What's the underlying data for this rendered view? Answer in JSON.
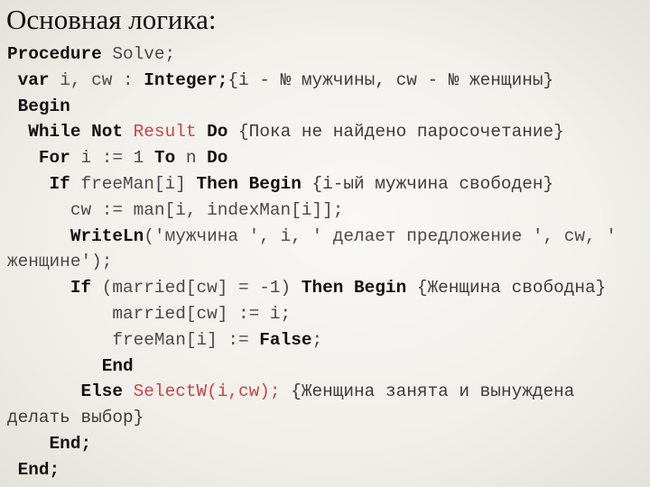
{
  "slide": {
    "title": "Основная логика:",
    "colors": {
      "background": "#f1efe9",
      "keyword": "#111111",
      "text": "#444444",
      "highlight": "#c8444a"
    },
    "code_lines": [
      {
        "indent": 0,
        "tokens": [
          {
            "t": "Procedure",
            "k": "kw"
          },
          {
            "t": " Solve;",
            "k": "id"
          }
        ]
      },
      {
        "indent": 1,
        "tokens": [
          {
            "t": "var",
            "k": "kw"
          },
          {
            "t": " i, cw : ",
            "k": "id"
          },
          {
            "t": "Integer;",
            "k": "kw"
          },
          {
            "t": "{i - № мужчины, cw - № женщины}",
            "k": "cm"
          }
        ]
      },
      {
        "indent": 1,
        "tokens": [
          {
            "t": "Begin",
            "k": "kw"
          }
        ]
      },
      {
        "indent": 2,
        "tokens": [
          {
            "t": "While Not",
            "k": "kw"
          },
          {
            "t": " ",
            "k": "id"
          },
          {
            "t": "Result",
            "k": "red"
          },
          {
            "t": " ",
            "k": "id"
          },
          {
            "t": "Do",
            "k": "kw"
          },
          {
            "t": " {Пока не найдено паросочетание}",
            "k": "cm"
          }
        ]
      },
      {
        "indent": 3,
        "tokens": [
          {
            "t": "For",
            "k": "kw"
          },
          {
            "t": " i := 1 ",
            "k": "id"
          },
          {
            "t": "To",
            "k": "kw"
          },
          {
            "t": " n ",
            "k": "id"
          },
          {
            "t": "Do",
            "k": "kw"
          }
        ]
      },
      {
        "indent": 4,
        "tokens": [
          {
            "t": "If",
            "k": "kw"
          },
          {
            "t": " freeMan[i] ",
            "k": "id"
          },
          {
            "t": "Then Begin",
            "k": "kw"
          },
          {
            "t": " {i-ый мужчина свободен}",
            "k": "cm"
          }
        ]
      },
      {
        "indent": 6,
        "tokens": [
          {
            "t": "cw := man[i, indexMan[i]];",
            "k": "id"
          }
        ]
      },
      {
        "indent": 6,
        "tokens": [
          {
            "t": "WriteLn",
            "k": "kw"
          },
          {
            "t": "('мужчина ', i, ' делает предложение ', cw, '",
            "k": "id"
          }
        ]
      },
      {
        "indent": 0,
        "tokens": [
          {
            "t": "женщине');",
            "k": "id"
          }
        ]
      },
      {
        "indent": 6,
        "tokens": [
          {
            "t": "If",
            "k": "kw"
          },
          {
            "t": " (married[cw] = -1) ",
            "k": "id"
          },
          {
            "t": "Then Begin",
            "k": "kw"
          },
          {
            "t": " {Женщина свободна}",
            "k": "cm"
          }
        ]
      },
      {
        "indent": 10,
        "tokens": [
          {
            "t": "married[cw] := i;",
            "k": "id"
          }
        ]
      },
      {
        "indent": 10,
        "tokens": [
          {
            "t": "freeMan[i] := ",
            "k": "id"
          },
          {
            "t": "False",
            "k": "kw"
          },
          {
            "t": ";",
            "k": "id"
          }
        ]
      },
      {
        "indent": 9,
        "tokens": [
          {
            "t": "End",
            "k": "kw"
          }
        ]
      },
      {
        "indent": 7,
        "tokens": [
          {
            "t": "Else",
            "k": "kw"
          },
          {
            "t": " ",
            "k": "id"
          },
          {
            "t": "SelectW(i,cw);",
            "k": "red"
          },
          {
            "t": " {Женщина занята и вынуждена",
            "k": "cm"
          }
        ]
      },
      {
        "indent": 0,
        "tokens": [
          {
            "t": "делать выбор}",
            "k": "cm"
          }
        ]
      },
      {
        "indent": 4,
        "tokens": [
          {
            "t": "End;",
            "k": "kw"
          }
        ]
      },
      {
        "indent": 1,
        "tokens": [
          {
            "t": "End;",
            "k": "kw"
          }
        ]
      }
    ]
  }
}
